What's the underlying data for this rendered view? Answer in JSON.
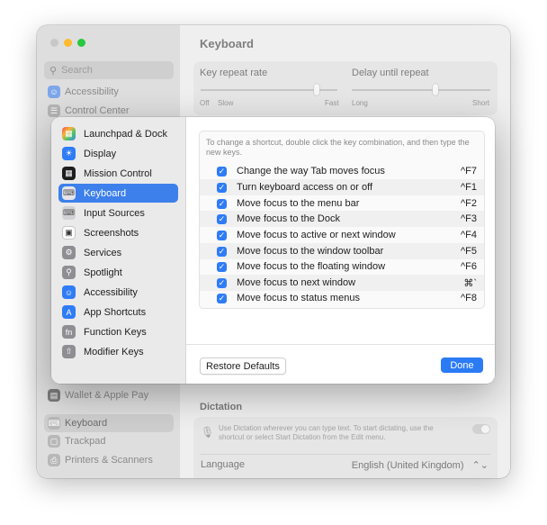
{
  "window": {
    "title": "Keyboard",
    "search_placeholder": "Search",
    "sidebar_items": [
      {
        "label": "Accessibility",
        "icon": "accessibility-icon",
        "color": "#3b82f6"
      },
      {
        "label": "Control Center",
        "icon": "control-center-icon",
        "color": "#8e8e93"
      },
      {
        "label": "Wallet & Apple Pay",
        "icon": "wallet-icon",
        "color": "#3a3a3c"
      },
      {
        "label": "Keyboard",
        "icon": "keyboard-icon",
        "color": "#8e8e93"
      },
      {
        "label": "Trackpad",
        "icon": "trackpad-icon",
        "color": "#8e8e93"
      },
      {
        "label": "Printers & Scanners",
        "icon": "printer-icon",
        "color": "#8e8e93"
      }
    ],
    "key_repeat": {
      "label": "Key repeat rate",
      "min_label": "Off",
      "slow_label": "Slow",
      "fast_label": "Fast"
    },
    "delay_repeat": {
      "label": "Delay until repeat",
      "long_label": "Long",
      "short_label": "Short"
    },
    "dictation": {
      "title": "Dictation",
      "description": "Use Dictation wherever you can type text. To start dictating, use the shortcut or select Start Dictation from the Edit menu.",
      "language_label": "Language",
      "language_value": "English (United Kingdom)",
      "stepper_glyph": "⌃⌄"
    }
  },
  "sheet": {
    "categories": [
      {
        "label": "Launchpad & Dock",
        "icon": "launchpad-icon",
        "color": "#ffffff",
        "selected": false
      },
      {
        "label": "Display",
        "icon": "display-icon",
        "color": "#2f7cf6",
        "selected": false
      },
      {
        "label": "Mission Control",
        "icon": "mission-control-icon",
        "color": "#1d1d1f",
        "selected": false
      },
      {
        "label": "Keyboard",
        "icon": "keyboard-icon",
        "color": "#e5e5ea",
        "selected": true
      },
      {
        "label": "Input Sources",
        "icon": "input-sources-icon",
        "color": "#d1d1d6",
        "selected": false
      },
      {
        "label": "Screenshots",
        "icon": "screenshots-icon",
        "color": "#ffffff",
        "selected": false
      },
      {
        "label": "Services",
        "icon": "services-icon",
        "color": "#8e8e93",
        "selected": false
      },
      {
        "label": "Spotlight",
        "icon": "spotlight-icon",
        "color": "#8e8e93",
        "selected": false
      },
      {
        "label": "Accessibility",
        "icon": "accessibility-icon",
        "color": "#2f7cf6",
        "selected": false
      },
      {
        "label": "App Shortcuts",
        "icon": "app-shortcuts-icon",
        "color": "#2f7cf6",
        "selected": false
      },
      {
        "label": "Function Keys",
        "icon": "function-keys-icon",
        "color": "#8e8e93",
        "selected": false
      },
      {
        "label": "Modifier Keys",
        "icon": "modifier-keys-icon",
        "color": "#8e8e93",
        "selected": false
      }
    ],
    "hint": "To change a shortcut, double click the key combination, and then type the new keys.",
    "shortcuts": [
      {
        "label": "Change the way Tab moves focus",
        "key": "^F7",
        "checked": true
      },
      {
        "label": "Turn keyboard access on or off",
        "key": "^F1",
        "checked": true
      },
      {
        "label": "Move focus to the menu bar",
        "key": "^F2",
        "checked": true
      },
      {
        "label": "Move focus to the Dock",
        "key": "^F3",
        "checked": true
      },
      {
        "label": "Move focus to active or next window",
        "key": "^F4",
        "checked": true
      },
      {
        "label": "Move focus to the window toolbar",
        "key": "^F5",
        "checked": true
      },
      {
        "label": "Move focus to the floating window",
        "key": "^F6",
        "checked": true
      },
      {
        "label": "Move focus to next window",
        "key": "⌘`",
        "checked": true
      },
      {
        "label": "Move focus to status menus",
        "key": "^F8",
        "checked": true
      }
    ],
    "restore_label": "Restore Defaults",
    "done_label": "Done",
    "accent_color": "#2b7bf5"
  }
}
